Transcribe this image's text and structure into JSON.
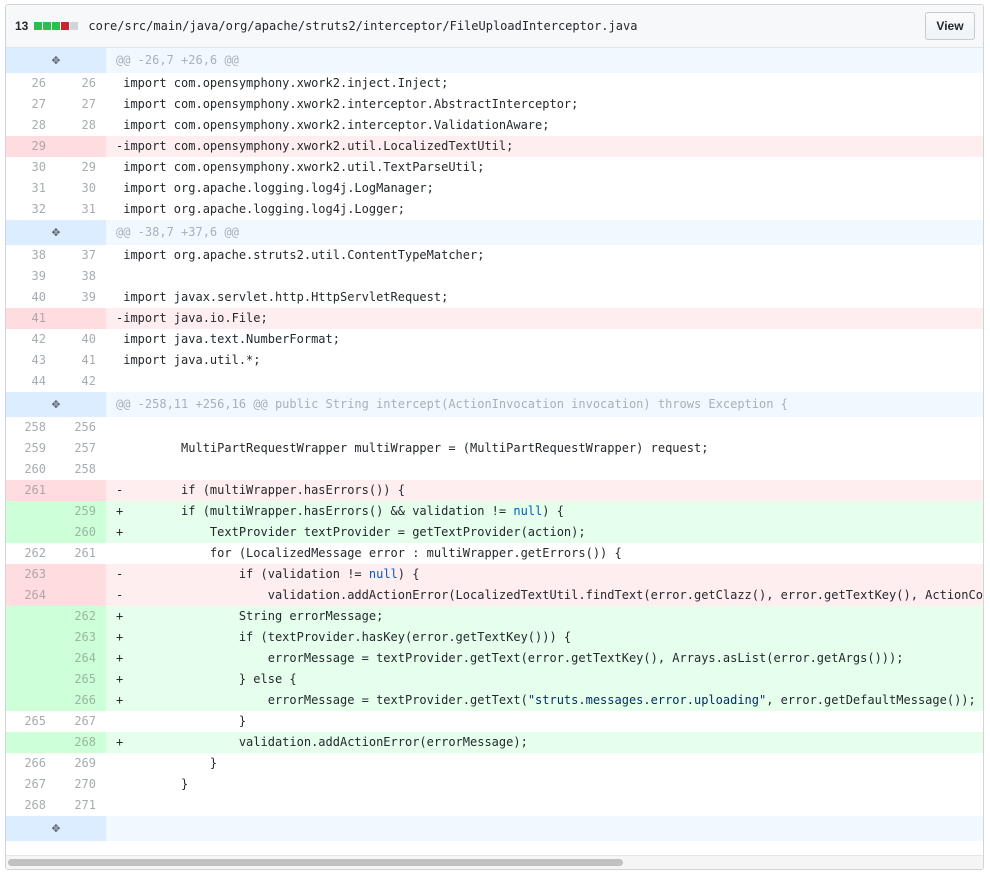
{
  "file_header": {
    "change_count": "13",
    "stat_colors": [
      "#2cbe4e",
      "#2cbe4e",
      "#2cbe4e",
      "#cb2431",
      "#d1d5da"
    ],
    "path": "core/src/main/java/org/apache/struts2/interceptor/FileUploadInterceptor.java",
    "view_label": "View"
  },
  "diff_rows": [
    {
      "type": "hunk",
      "text": "@@ -26,7 +26,6 @@"
    },
    {
      "type": "ctx",
      "old": "26",
      "new": "26",
      "text": " import com.opensymphony.xwork2.inject.Inject;"
    },
    {
      "type": "ctx",
      "old": "27",
      "new": "27",
      "text": " import com.opensymphony.xwork2.interceptor.AbstractInterceptor;"
    },
    {
      "type": "ctx",
      "old": "28",
      "new": "28",
      "text": " import com.opensymphony.xwork2.interceptor.ValidationAware;"
    },
    {
      "type": "del",
      "old": "29",
      "new": "",
      "text": "-import com.opensymphony.xwork2.util.LocalizedTextUtil;"
    },
    {
      "type": "ctx",
      "old": "30",
      "new": "29",
      "text": " import com.opensymphony.xwork2.util.TextParseUtil;"
    },
    {
      "type": "ctx",
      "old": "31",
      "new": "30",
      "text": " import org.apache.logging.log4j.LogManager;"
    },
    {
      "type": "ctx",
      "old": "32",
      "new": "31",
      "text": " import org.apache.logging.log4j.Logger;"
    },
    {
      "type": "hunk",
      "text": "@@ -38,7 +37,6 @@"
    },
    {
      "type": "ctx",
      "old": "38",
      "new": "37",
      "text": " import org.apache.struts2.util.ContentTypeMatcher;"
    },
    {
      "type": "ctx",
      "old": "39",
      "new": "38",
      "text": ""
    },
    {
      "type": "ctx",
      "old": "40",
      "new": "39",
      "text": " import javax.servlet.http.HttpServletRequest;"
    },
    {
      "type": "del",
      "old": "41",
      "new": "",
      "text": "-import java.io.File;"
    },
    {
      "type": "ctx",
      "old": "42",
      "new": "40",
      "text": " import java.text.NumberFormat;"
    },
    {
      "type": "ctx",
      "old": "43",
      "new": "41",
      "text": " import java.util.*;"
    },
    {
      "type": "ctx",
      "old": "44",
      "new": "42",
      "text": ""
    },
    {
      "type": "hunk",
      "text": "@@ -258,11 +256,16 @@ public String intercept(ActionInvocation invocation) throws Exception {"
    },
    {
      "type": "ctx",
      "old": "258",
      "new": "256",
      "text": ""
    },
    {
      "type": "ctx",
      "old": "259",
      "new": "257",
      "text": "         MultiPartRequestWrapper multiWrapper = (MultiPartRequestWrapper) request;"
    },
    {
      "type": "ctx",
      "old": "260",
      "new": "258",
      "text": ""
    },
    {
      "type": "del",
      "old": "261",
      "new": "",
      "text": "-        if (multiWrapper.hasErrors()) {"
    },
    {
      "type": "add",
      "old": "",
      "new": "259",
      "text": "+        if (multiWrapper.hasErrors() && validation != null) {"
    },
    {
      "type": "add",
      "old": "",
      "new": "260",
      "text": "+            TextProvider textProvider = getTextProvider(action);"
    },
    {
      "type": "ctx",
      "old": "262",
      "new": "261",
      "text": "             for (LocalizedMessage error : multiWrapper.getErrors()) {"
    },
    {
      "type": "del",
      "old": "263",
      "new": "",
      "text": "-                if (validation != null) {"
    },
    {
      "type": "del",
      "old": "264",
      "new": "",
      "text": "-                    validation.addActionError(LocalizedTextUtil.findText(error.getClazz(), error.getTextKey(), ActionCon"
    },
    {
      "type": "add",
      "old": "",
      "new": "262",
      "text": "+                String errorMessage;"
    },
    {
      "type": "add",
      "old": "",
      "new": "263",
      "text": "+                if (textProvider.hasKey(error.getTextKey())) {"
    },
    {
      "type": "add",
      "old": "",
      "new": "264",
      "text": "+                    errorMessage = textProvider.getText(error.getTextKey(), Arrays.asList(error.getArgs()));"
    },
    {
      "type": "add",
      "old": "",
      "new": "265",
      "text": "+                } else {"
    },
    {
      "type": "add",
      "old": "",
      "new": "266",
      "text": "+                    errorMessage = textProvider.getText(\"struts.messages.error.uploading\", error.getDefaultMessage());"
    },
    {
      "type": "ctx",
      "old": "265",
      "new": "267",
      "text": "                 }"
    },
    {
      "type": "add",
      "old": "",
      "new": "268",
      "text": "+                validation.addActionError(errorMessage);"
    },
    {
      "type": "ctx",
      "old": "266",
      "new": "269",
      "text": "             }"
    },
    {
      "type": "ctx",
      "old": "267",
      "new": "270",
      "text": "         }"
    },
    {
      "type": "ctx",
      "old": "268",
      "new": "271",
      "text": ""
    },
    {
      "type": "hunk",
      "text": ""
    }
  ],
  "icons": {
    "expand": "unfold-icon"
  }
}
